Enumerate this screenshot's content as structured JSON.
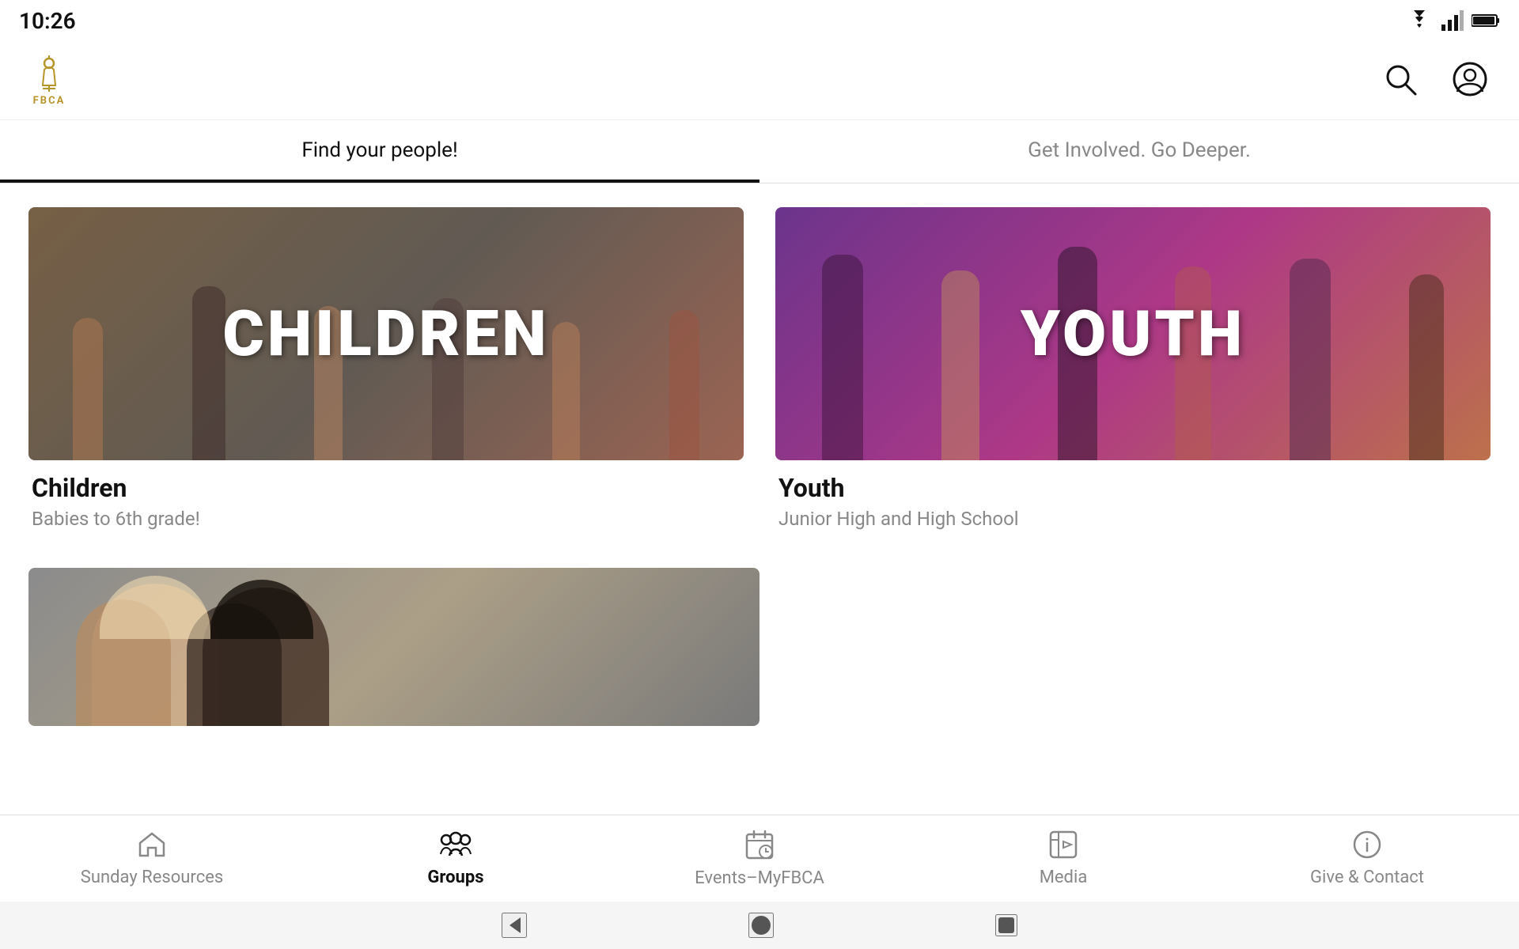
{
  "statusBar": {
    "time": "10:26"
  },
  "header": {
    "logo": "FBCA",
    "logoSymbol": "⛪"
  },
  "tabs": [
    {
      "id": "find-people",
      "label": "Find your people!",
      "active": true
    },
    {
      "id": "get-involved",
      "label": "Get Involved. Go Deeper.",
      "active": false
    }
  ],
  "groups": [
    {
      "id": "children",
      "imageLabel": "CHILDREN",
      "title": "Children",
      "subtitle": "Babies to 6th grade!",
      "colorTheme": "children"
    },
    {
      "id": "youth",
      "imageLabel": "YOUTH",
      "title": "Youth",
      "subtitle": "Junior High and High School",
      "colorTheme": "youth"
    }
  ],
  "bottomNav": [
    {
      "id": "sunday-resources",
      "label": "Sunday Resources",
      "icon": "home",
      "active": false
    },
    {
      "id": "groups",
      "label": "Groups",
      "icon": "groups",
      "active": true
    },
    {
      "id": "events",
      "label": "Events–MyFBCA",
      "icon": "events",
      "active": false
    },
    {
      "id": "media",
      "label": "Media",
      "icon": "media",
      "active": false
    },
    {
      "id": "give-contact",
      "label": "Give & Contact",
      "icon": "info",
      "active": false
    }
  ],
  "systemNav": {
    "back": "◀",
    "home": "●",
    "recent": "■"
  }
}
